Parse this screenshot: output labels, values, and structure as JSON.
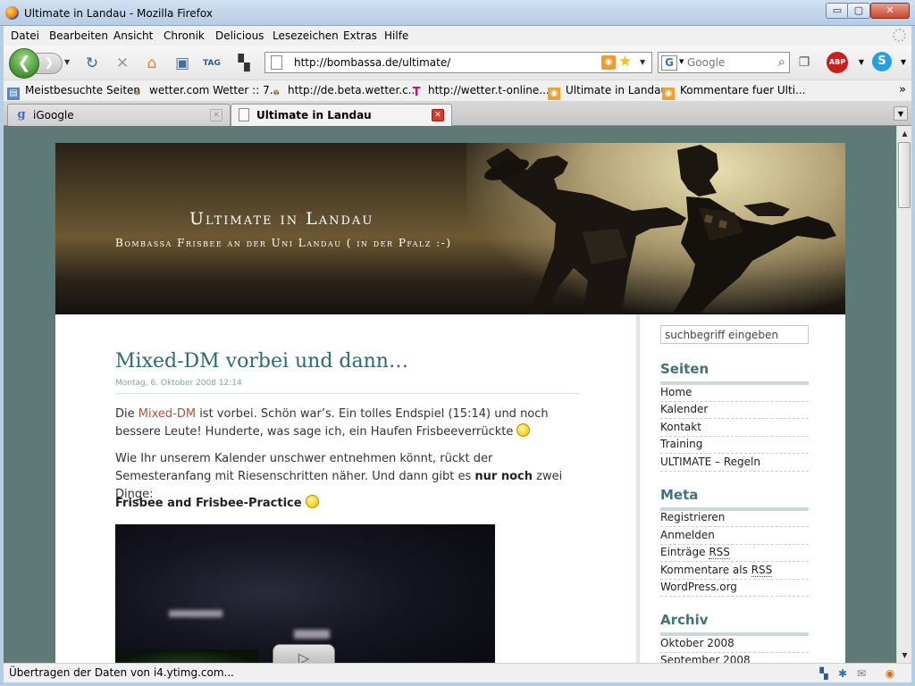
{
  "window": {
    "title": "Ultimate in Landau - Mozilla Firefox",
    "minimize": "▭",
    "maximize": "▢",
    "close": "✕"
  },
  "menu": [
    {
      "label": "Datei"
    },
    {
      "label": "Bearbeiten"
    },
    {
      "label": "Ansicht"
    },
    {
      "label": "Chronik"
    },
    {
      "label": "Delicious"
    },
    {
      "label": "Lesezeichen"
    },
    {
      "label": "Extras"
    },
    {
      "label": "Hilfe"
    }
  ],
  "nav": {
    "back_glyph": "❮",
    "forward_glyph": "❯",
    "dropdown_glyph": "▼",
    "url": "http://bombassa.de/ultimate/",
    "search_placeholder": "Google",
    "search_engine_glyph": "G"
  },
  "bookmarks": [
    {
      "label": "Meistbesuchte Seiten",
      "icon": "folder-icon"
    },
    {
      "label": "wetter.com Wetter :: 7...",
      "icon": "bee-icon"
    },
    {
      "label": "http://de.beta.wetter.c...",
      "icon": "bee-icon"
    },
    {
      "label": "http://wetter.t-online....",
      "icon": "telekom-icon"
    },
    {
      "label": "Ultimate in Landau",
      "icon": "rss-icon"
    },
    {
      "label": "Kommentare fuer Ulti...",
      "icon": "rss-icon"
    }
  ],
  "bookmarks_more": "»",
  "tabs": [
    {
      "label": "iGoogle",
      "active": false
    },
    {
      "label": "Ultimate in Landau",
      "active": true
    }
  ],
  "blog": {
    "title": "Ultimate in Landau",
    "description": "Bombassa Frisbee an der Uni Landau ( in der Pfalz :-)"
  },
  "post": {
    "title": "Mixed-DM vorbei und dann…",
    "date": "Montag, 6. Oktober 2008 12:14",
    "p1_pre": "Die ",
    "p1_link": "Mixed-DM",
    "p1_post": " ist vorbei. Schön war’s. Ein tolles Endspiel (15:14) und noch bessere Leute! Hunderte, was sage ich, ein Haufen Frisbeeverrückte ",
    "p2_pre": "Wie Ihr unserem Kalender unschwer entnehmen könnt, rückt der Semesteranfang mit Riesenschritten näher. Und dann gibt es ",
    "p2_bold": "nur noch",
    "p2_post": " zwei Dinge:",
    "p3_bold": "Frisbee and Frisbee-Practice",
    "video_play": "▷"
  },
  "sidebar": {
    "search_placeholder": "suchbegriff eingeben",
    "seiten_heading": "Seiten",
    "seiten": [
      "Home",
      "Kalender",
      "Kontakt",
      "Training",
      "ULTIMATE – Regeln"
    ],
    "meta_heading": "Meta",
    "meta": {
      "register": "Registrieren",
      "login": "Anmelden",
      "entries_pre": "Einträge ",
      "comments_pre": "Kommentare als ",
      "rss": "RSS",
      "wordpress": "WordPress.org"
    },
    "archiv_heading": "Archiv",
    "archiv": [
      "Oktober 2008",
      "September 2008"
    ]
  },
  "status": {
    "text": "Übertragen der Daten von i4.ytimg.com..."
  },
  "colors": {
    "accent_title": "#2d6a74",
    "link": "#b4523a",
    "sidebar_heading": "#3f7379",
    "page_bg": "#5e7a77"
  }
}
